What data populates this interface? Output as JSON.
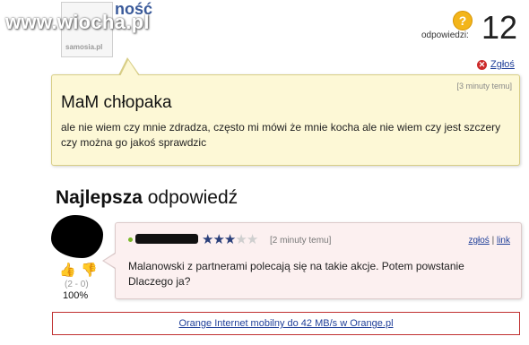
{
  "watermark": "www.wiocha.pl",
  "asker": {
    "name_partial": "ność",
    "avatar_tag": "samosia.pl"
  },
  "answers": {
    "label": "odpowiedzi:",
    "count": "12"
  },
  "report_link": "Zgłoś",
  "question": {
    "time": "[3 minuty temu]",
    "title": "MaM chłopaka",
    "body": "ale nie wiem czy mnie zdradza, często mi mówi że mnie kocha ale nie wiem czy jest szczery czy można go jakoś sprawdzic"
  },
  "best_answer": {
    "heading_bold": "Najlepsza",
    "heading_rest": " odpowiedź",
    "rating": {
      "value": 2.5,
      "max": 5
    },
    "time": "[2 minuty temu]",
    "report_link": "zgłoś",
    "separator": "|",
    "link_label": "link",
    "body": "Malanowski z partnerami polecają się na takie akcje. Potem powstanie Dlaczego ja?",
    "votes": "(2 - 0)",
    "percent": "100%"
  },
  "ad": {
    "text": "Orange Internet mobilny do 42 MB/s w Orange.pl"
  },
  "colors": {
    "question_bg": "#fdf8d6",
    "answer_bg": "#fcf0f0",
    "link": "#1f3f99",
    "ad_border": "#c03030"
  }
}
